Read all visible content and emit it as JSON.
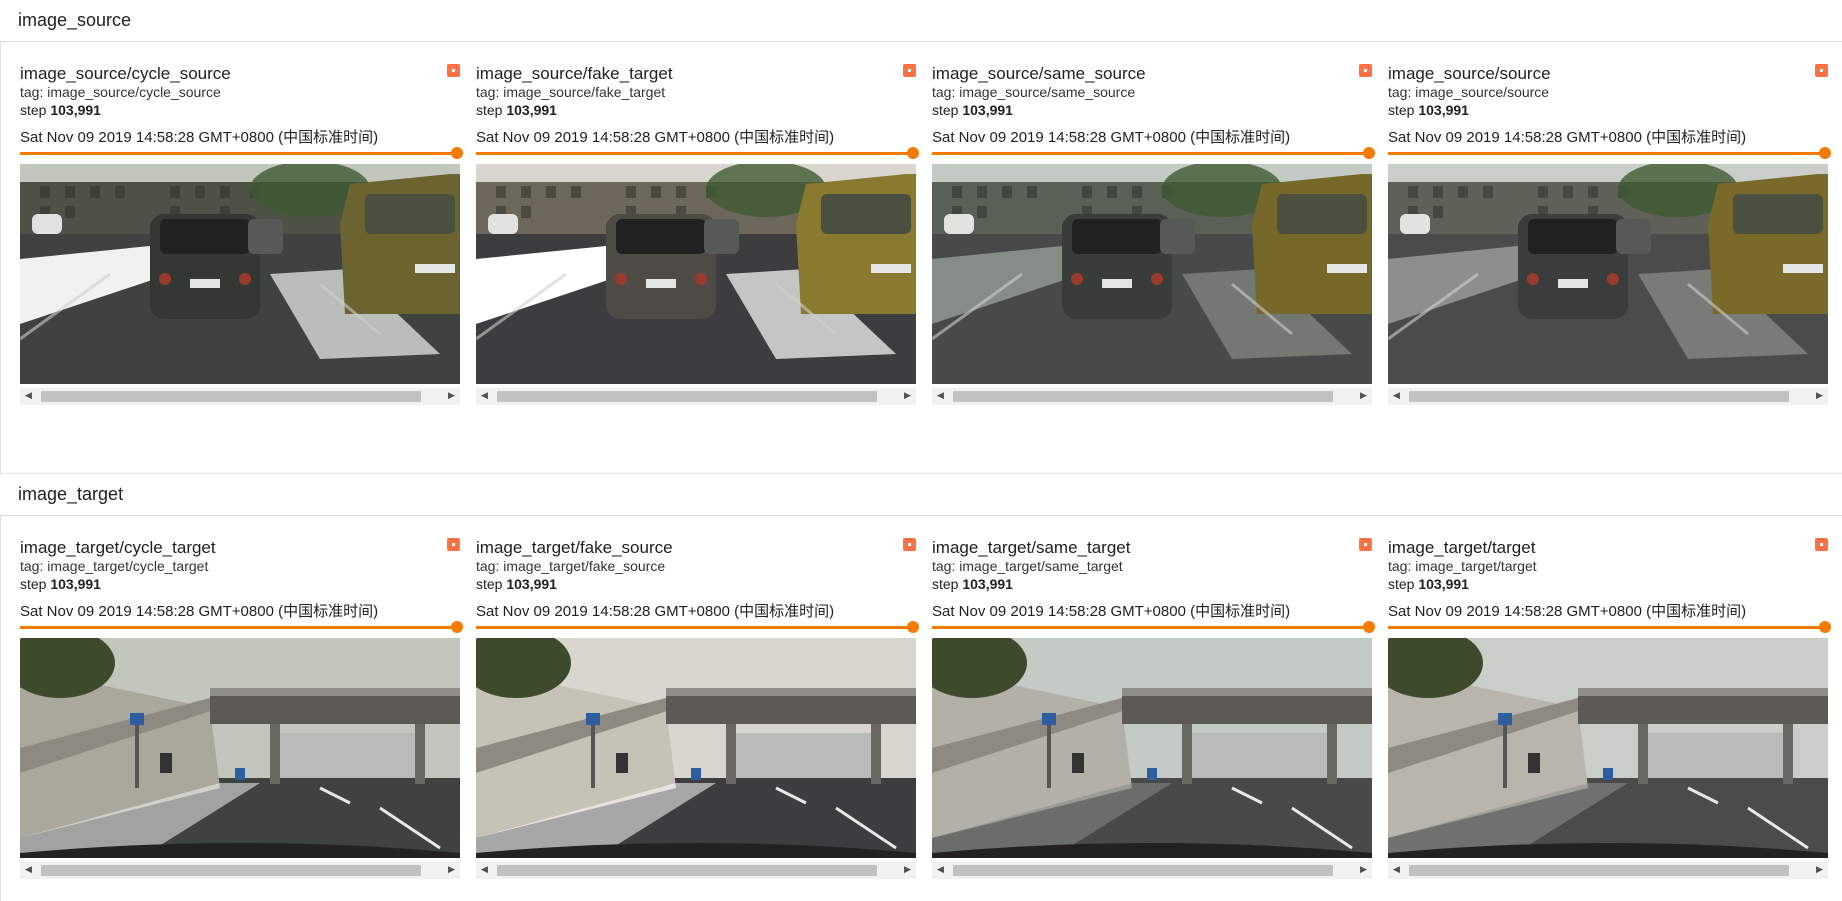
{
  "sections": [
    {
      "title": "image_source",
      "cards": [
        {
          "title": "image_source/cycle_source",
          "tag": "tag: image_source/cycle_source",
          "step_label": "step",
          "step_value": "103,991",
          "time": "Sat Nov 09 2019 14:58:28 GMT+0800 (中国标准时间)",
          "variant": "cycle"
        },
        {
          "title": "image_source/fake_target",
          "tag": "tag: image_source/fake_target",
          "step_label": "step",
          "step_value": "103,991",
          "time": "Sat Nov 09 2019 14:58:28 GMT+0800 (中国标准时间)",
          "variant": "fake"
        },
        {
          "title": "image_source/same_source",
          "tag": "tag: image_source/same_source",
          "step_label": "step",
          "step_value": "103,991",
          "time": "Sat Nov 09 2019 14:58:28 GMT+0800 (中国标准时间)",
          "variant": "same"
        },
        {
          "title": "image_source/source",
          "tag": "tag: image_source/source",
          "step_label": "step",
          "step_value": "103,991",
          "time": "Sat Nov 09 2019 14:58:28 GMT+0800 (中国标准时间)",
          "variant": "real"
        }
      ]
    },
    {
      "title": "image_target",
      "cards": [
        {
          "title": "image_target/cycle_target",
          "tag": "tag: image_target/cycle_target",
          "step_label": "step",
          "step_value": "103,991",
          "time": "Sat Nov 09 2019 14:58:28 GMT+0800 (中国标准时间)",
          "variant": "cycle"
        },
        {
          "title": "image_target/fake_source",
          "tag": "tag: image_target/fake_source",
          "step_label": "step",
          "step_value": "103,991",
          "time": "Sat Nov 09 2019 14:58:28 GMT+0800 (中国标准时间)",
          "variant": "fake"
        },
        {
          "title": "image_target/same_target",
          "tag": "tag: image_target/same_target",
          "step_label": "step",
          "step_value": "103,991",
          "time": "Sat Nov 09 2019 14:58:28 GMT+0800 (中国标准时间)",
          "variant": "same"
        },
        {
          "title": "image_target/target",
          "tag": "tag: image_target/target",
          "step_label": "step",
          "step_value": "103,991",
          "time": "Sat Nov 09 2019 14:58:28 GMT+0800 (中国标准时间)",
          "variant": "real"
        }
      ]
    }
  ],
  "slider_value": 1.0,
  "icons": {
    "pin": "pin-icon",
    "scroll_left": "scroll-left-arrow-icon",
    "scroll_right": "scroll-right-arrow-icon"
  },
  "colors": {
    "accent": "#f57c00",
    "pin": "#ff7043"
  }
}
